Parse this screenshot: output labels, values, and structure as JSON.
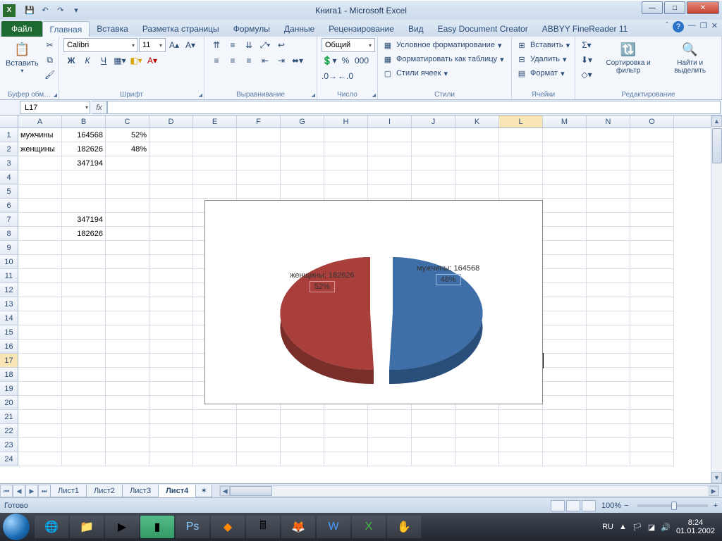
{
  "title": "Книга1 - Microsoft Excel",
  "qat": {
    "save": "💾",
    "undo": "↶",
    "redo": "↷"
  },
  "file_tab": "Файл",
  "tabs": [
    "Главная",
    "Вставка",
    "Разметка страницы",
    "Формулы",
    "Данные",
    "Рецензирование",
    "Вид",
    "Easy Document Creator",
    "ABBYY FineReader 11"
  ],
  "active_tab": 0,
  "ribbon": {
    "clipboard": {
      "label": "Буфер обм…",
      "paste": "Вставить"
    },
    "font": {
      "label": "Шрифт",
      "name": "Calibri",
      "size": "11"
    },
    "alignment": {
      "label": "Выравнивание"
    },
    "number": {
      "label": "Число",
      "format": "Общий"
    },
    "styles": {
      "label": "Стили",
      "cond": "Условное форматирование",
      "table": "Форматировать как таблицу",
      "cell": "Стили ячеек"
    },
    "cells": {
      "label": "Ячейки",
      "insert": "Вставить",
      "delete": "Удалить",
      "format": "Формат"
    },
    "editing": {
      "label": "Редактирование",
      "sort": "Сортировка и фильтр",
      "find": "Найти и выделить"
    }
  },
  "namebox": "L17",
  "fx": "fx",
  "columns": [
    "A",
    "B",
    "C",
    "D",
    "E",
    "F",
    "G",
    "H",
    "I",
    "J",
    "K",
    "L",
    "M",
    "N",
    "O"
  ],
  "active_col": "L",
  "active_row": 17,
  "cells": {
    "A1": "мужчины",
    "B1": "164568",
    "C1": "52%",
    "A2": "женщины",
    "B2": "182626",
    "C2": "48%",
    "B3": "347194",
    "B7": "347194",
    "B8": "182626"
  },
  "sheets": [
    "Лист1",
    "Лист2",
    "Лист3",
    "Лист4"
  ],
  "active_sheet": 3,
  "status": "Готово",
  "zoom": "100%",
  "lang": "RU",
  "clock": {
    "time": "8:24",
    "date": "01.01.2002"
  },
  "chart_data": {
    "type": "pie",
    "title": "",
    "series": [
      {
        "name": "женщины",
        "value": 182626,
        "pct": 52,
        "color": "#a83f3a"
      },
      {
        "name": "мужчины",
        "value": 164568,
        "pct": 48,
        "color": "#3f6fa8"
      }
    ],
    "labels": {
      "women": "женщины; 182626",
      "women_pct": "52%",
      "men": "мужчины; 164568",
      "men_pct": "48%"
    }
  }
}
